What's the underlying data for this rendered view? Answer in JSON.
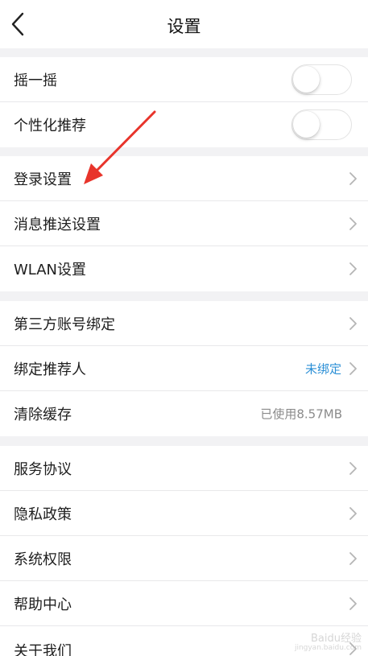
{
  "header": {
    "title": "设置",
    "back_icon": "chevron-left-icon"
  },
  "group1": [
    {
      "label": "摇一摇",
      "toggle": false
    },
    {
      "label": "个性化推荐",
      "toggle": false
    }
  ],
  "group2": [
    {
      "label": "登录设置"
    },
    {
      "label": "消息推送设置"
    },
    {
      "label": "WLAN设置"
    }
  ],
  "group3": [
    {
      "label": "第三方账号绑定"
    },
    {
      "label": "绑定推荐人",
      "value": "未绑定"
    },
    {
      "label": "清除缓存",
      "value": "已使用8.57MB"
    }
  ],
  "group4": [
    {
      "label": "服务协议"
    },
    {
      "label": "隐私政策"
    },
    {
      "label": "系统权限"
    },
    {
      "label": "帮助中心"
    },
    {
      "label": "关于我们"
    }
  ],
  "annotation": {
    "arrow_color": "#e8342b",
    "points_to": "登录设置"
  },
  "watermark": {
    "text": "Baidu经验",
    "sub": "jingyan.baidu.com"
  },
  "colors": {
    "accent_link": "#2b8fd6",
    "background": "#f2f2f4"
  }
}
